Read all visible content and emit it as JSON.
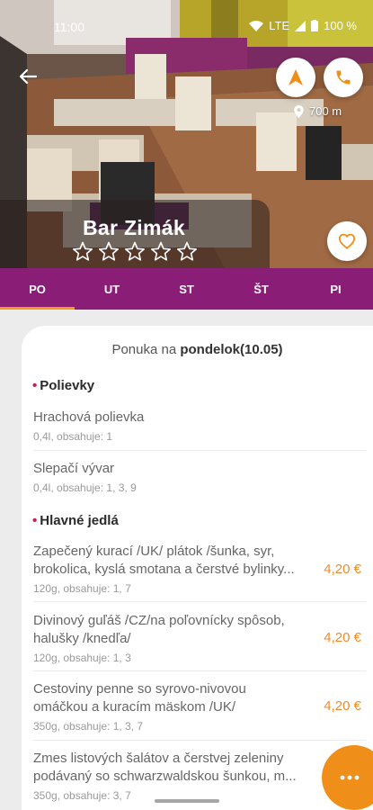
{
  "status": {
    "time": "11:00",
    "network": "LTE",
    "battery": "100 %"
  },
  "header": {
    "title": "Bar Zimák",
    "distance": "700 m",
    "icons": {
      "back": "back-arrow-icon",
      "navigate": "navigation-arrow-icon",
      "call": "phone-icon",
      "favorite": "heart-icon",
      "location": "location-pin-icon"
    }
  },
  "rating": {
    "stars_filled": 0,
    "stars_total": 5
  },
  "tabs": [
    {
      "label": "PO",
      "active": true
    },
    {
      "label": "UT",
      "active": false
    },
    {
      "label": "ST",
      "active": false
    },
    {
      "label": "ŠT",
      "active": false
    },
    {
      "label": "PI",
      "active": false
    }
  ],
  "menu": {
    "heading_prefix": "Ponuka na",
    "heading_day": "pondelok(10.05)",
    "sections": [
      {
        "title": "Polievky",
        "items": [
          {
            "name": "Hrachová polievka",
            "meta": "0,4l, obsahuje: 1",
            "price": ""
          },
          {
            "name": "Slepačí vývar",
            "meta": "0,4l, obsahuje: 1, 3, 9",
            "price": ""
          }
        ]
      },
      {
        "title": "Hlavné jedlá",
        "items": [
          {
            "name_line1": "Zapečený kurací /UK/ plátok /šunka, syr,",
            "name_line2": "brokolica, kyslá smotana a čerstvé bylinky...",
            "meta": "120g, obsahuje: 1, 7",
            "price": "4,20 €"
          },
          {
            "name_line1": "Divinový guľáš /CZ/na poľovnícky spôsob,",
            "name_line2": "halušky /knedľa/",
            "meta": "120g, obsahuje: 1, 3",
            "price": "4,20 €"
          },
          {
            "name_line1": "Cestoviny penne so syrovo-nivovou",
            "name_line2": "omáčkou a kuracím mäskom /UK/",
            "meta": "350g, obsahuje: 1, 3, 7",
            "price": "4,20 €"
          },
          {
            "name_line1": "Zmes listových šalátov a čerstvej zeleniny",
            "name_line2": "podávaný so schwarzwaldskou šunkou, m...",
            "meta": "350g, obsahuje: 3, 7",
            "price": ""
          }
        ]
      }
    ]
  },
  "colors": {
    "brand": "#8a1e76",
    "accent": "#ef8e18",
    "price": "#ef8b2c",
    "bullet": "#d2175a"
  },
  "fab": {
    "label": "•••",
    "icon": "more-dots-icon"
  }
}
